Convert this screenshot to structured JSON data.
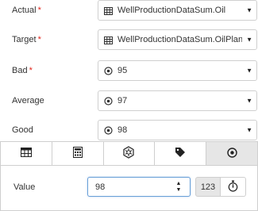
{
  "fields": [
    {
      "label": "Actual",
      "required": "*",
      "value": "WellProductionDataSum.Oil",
      "icon": "table-icon"
    },
    {
      "label": "Target",
      "required": "*",
      "value": "WellProductionDataSum.OilPlanr",
      "icon": "table-icon"
    },
    {
      "label": "Bad",
      "required": "*",
      "value": "95",
      "icon": "radio-dot-icon"
    },
    {
      "label": "Average",
      "required": "",
      "value": "97",
      "icon": "radio-dot-icon"
    },
    {
      "label": "Good",
      "required": "",
      "value": "98",
      "icon": "radio-dot-icon"
    }
  ],
  "tabs": [
    {
      "icon": "table-icon",
      "active": false
    },
    {
      "icon": "calculator-icon",
      "active": false
    },
    {
      "icon": "hexagon-network-icon",
      "active": false
    },
    {
      "icon": "tag-icon",
      "active": false
    },
    {
      "icon": "radio-dot-icon",
      "active": true
    }
  ],
  "value_panel": {
    "label": "Value",
    "input_value": "98",
    "mode_button": "123"
  },
  "colors": {
    "required_asterisk": "#e2231a",
    "active_tab": "#e6e6e6",
    "focus_border": "#6aa0d8"
  }
}
